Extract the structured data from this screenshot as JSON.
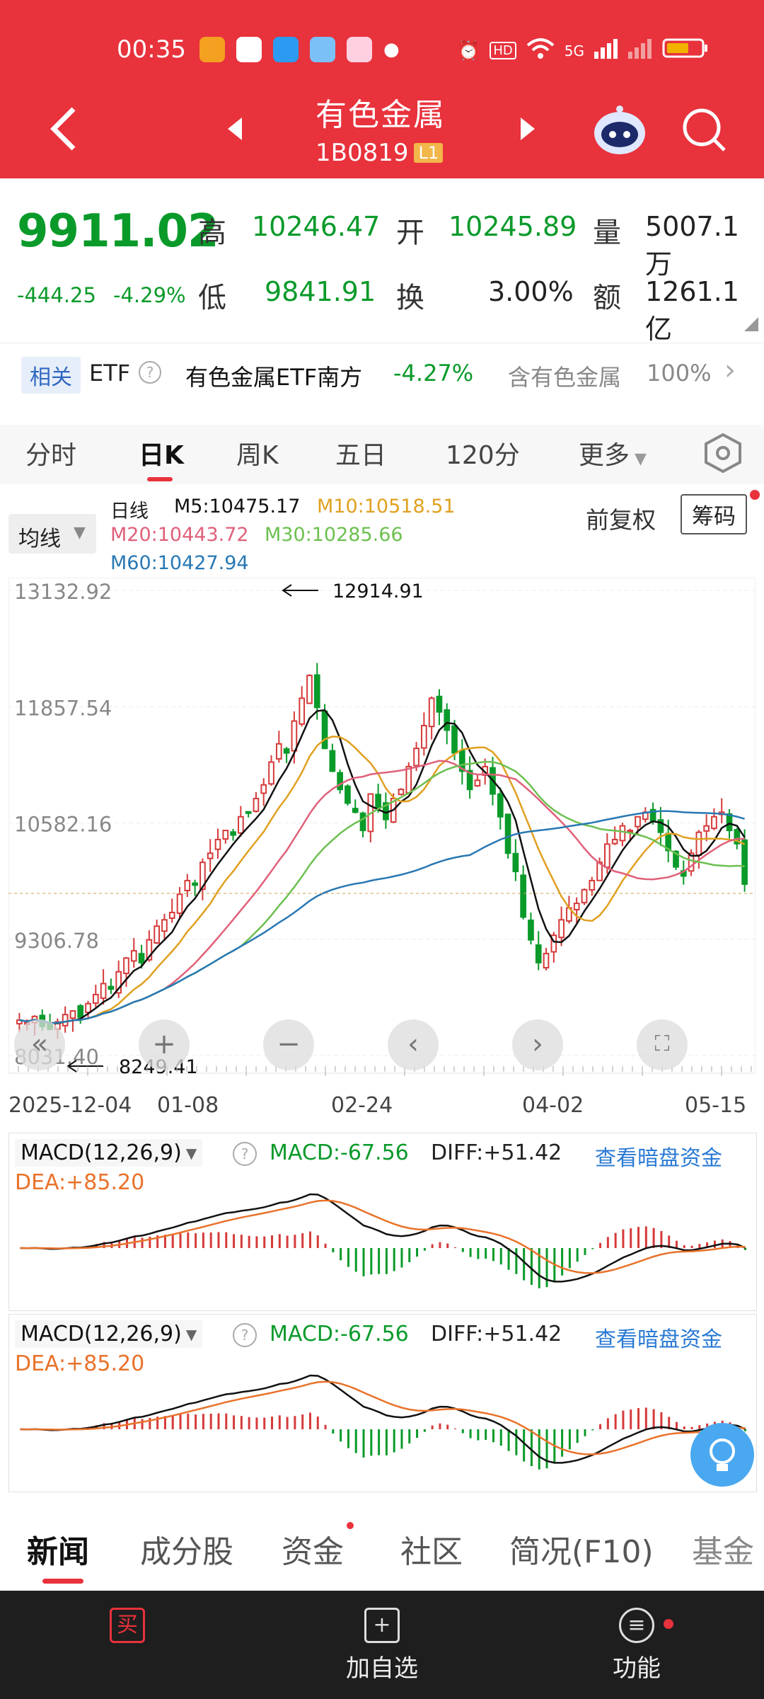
{
  "status_bar": {
    "time": "00:35",
    "network": "5G"
  },
  "header": {
    "title": "有色金属",
    "code": "1B0819",
    "level_badge": "L1"
  },
  "quote": {
    "price": "9911.02",
    "change": "-444.25",
    "change_pct": "-4.29%",
    "high_label": "高",
    "high": "10246.47",
    "open_label": "开",
    "open": "10245.89",
    "volume_label": "量",
    "volume": "5007.1万",
    "low_label": "低",
    "low": "9841.91",
    "turnover_label": "换",
    "turnover": "3.00%",
    "amount_label": "额",
    "amount": "1261.1亿"
  },
  "etf": {
    "tag": "相关",
    "type": "ETF",
    "name": "有色金属ETF南方",
    "change": "-4.27%",
    "holding_label": "含有色金属",
    "holding": "100%"
  },
  "chart_tabs": [
    {
      "label": "分时"
    },
    {
      "label": "日K",
      "active": true
    },
    {
      "label": "周K"
    },
    {
      "label": "五日"
    },
    {
      "label": "120分"
    },
    {
      "label": "更多"
    }
  ],
  "indicator": {
    "dropdown": "均线",
    "type_label": "日线",
    "ma5": "M5:10475.17",
    "ma10": "M10:10518.51",
    "ma20": "M20:10443.72",
    "ma30": "M30:10285.66",
    "ma60": "M60:10427.94",
    "adjust": "前复权",
    "chips_button": "筹码"
  },
  "colors": {
    "header": "#e8323c",
    "up": "#d63a3a",
    "down": "#0a9a2a",
    "ma5": "#111111",
    "ma10": "#e0a020",
    "ma20": "#e0607a",
    "ma30": "#6cc050",
    "ma60": "#2878b4",
    "link": "#2a7ad4"
  },
  "chart_data": {
    "type": "candlestick",
    "y_ticks": [
      "13132.92",
      "11857.54",
      "10582.16",
      "9306.78",
      "8031.40"
    ],
    "ylim": [
      8031.4,
      13132.92
    ],
    "x_ticks": [
      "2025-12-04",
      "01-08",
      "02-24",
      "04-02",
      "05-15"
    ],
    "max_annotation": "12914.91",
    "min_annotation": "8249.41",
    "closes": [
      8420,
      8390,
      8460,
      8350,
      8320,
      8400,
      8480,
      8520,
      8450,
      8600,
      8700,
      8820,
      8760,
      8950,
      9100,
      9180,
      9050,
      9300,
      9450,
      9520,
      9600,
      9800,
      9950,
      9900,
      10150,
      10250,
      10400,
      10500,
      10450,
      10650,
      10700,
      10850,
      11000,
      11250,
      11450,
      11350,
      11700,
      11950,
      12200,
      11850,
      11400,
      11150,
      10950,
      10800,
      10700,
      10500,
      10900,
      10750,
      10620,
      10850,
      10950,
      11200,
      11400,
      11650,
      11950,
      11800,
      11600,
      11350,
      11150,
      10950,
      11050,
      11200,
      10900,
      10650,
      10250,
      10050,
      9550,
      9300,
      9050,
      9150,
      9350,
      9520,
      9650,
      9700,
      9850,
      9950,
      10150,
      10350,
      10400,
      10550,
      10500,
      10650,
      10700,
      10600,
      10480,
      10280,
      10100,
      10000,
      10250,
      10480,
      10550,
      10650,
      10700,
      10500,
      10355,
      9911
    ]
  },
  "macd": {
    "title": "MACD(12,26,9)",
    "macd": "MACD:-67.56",
    "diff": "DIFF:+51.42",
    "dea": "DEA:+85.20",
    "link": "查看暗盘资金"
  },
  "bottom_tabs": [
    {
      "label": "新闻",
      "active": true
    },
    {
      "label": "成分股"
    },
    {
      "label": "资金"
    },
    {
      "label": "社区"
    },
    {
      "label": "简况(F10)"
    },
    {
      "label": "基金"
    }
  ],
  "bottom_bar": {
    "buy": "买",
    "watchlist": "加自选",
    "function": "功能"
  }
}
